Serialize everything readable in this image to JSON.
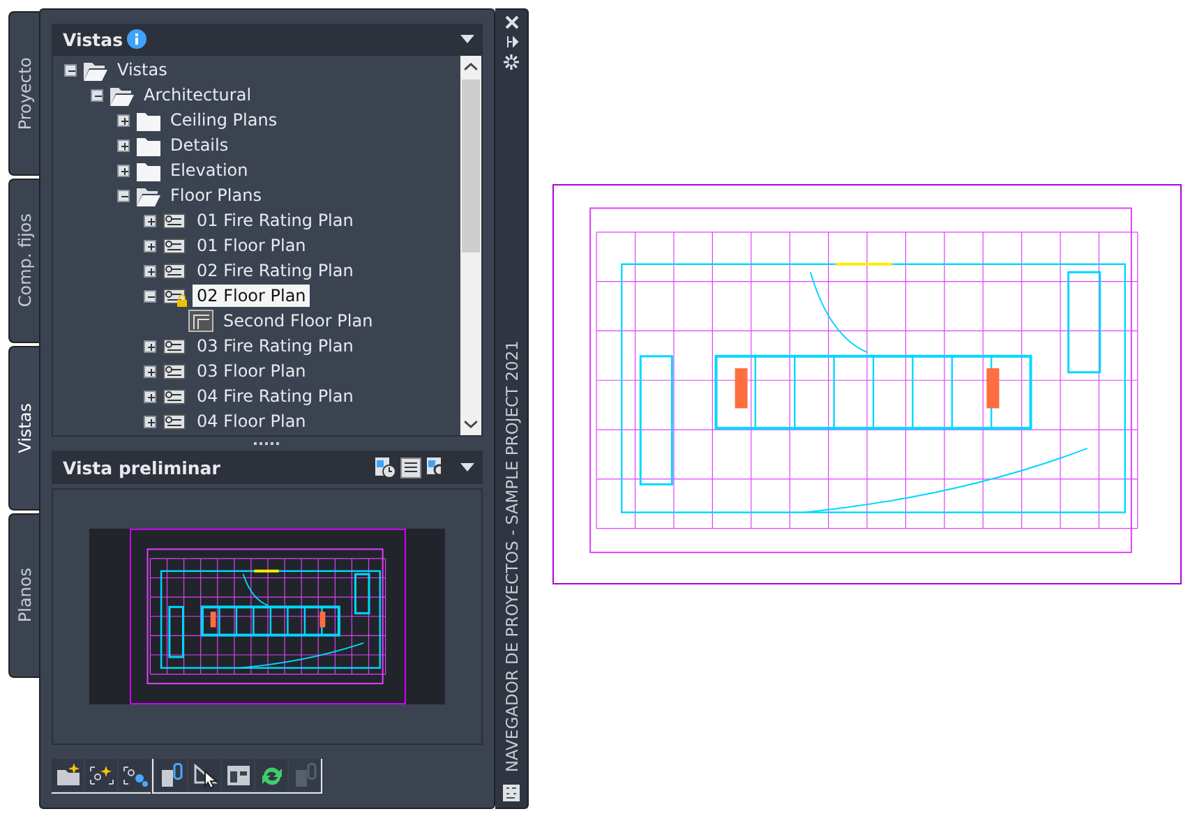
{
  "side_tabs": [
    {
      "label": "Proyecto",
      "selected": false
    },
    {
      "label": "Comp. fijos",
      "selected": false
    },
    {
      "label": "Vistas",
      "selected": true
    },
    {
      "label": "Planos",
      "selected": false
    }
  ],
  "views_panel": {
    "title": "Vistas",
    "tree": [
      {
        "label": "Vistas",
        "kind": "folder",
        "expanded": true,
        "selected": false,
        "children": [
          {
            "label": "Architectural",
            "kind": "folder",
            "expanded": true,
            "selected": false,
            "children": [
              {
                "label": "Ceiling Plans",
                "kind": "folder",
                "expanded": false,
                "selected": false
              },
              {
                "label": "Details",
                "kind": "folder",
                "expanded": false,
                "selected": false
              },
              {
                "label": "Elevation",
                "kind": "folder",
                "expanded": false,
                "selected": false
              },
              {
                "label": "Floor Plans",
                "kind": "folder",
                "expanded": true,
                "selected": false,
                "children": [
                  {
                    "label": "01 Fire Rating Plan",
                    "kind": "view",
                    "expanded": false,
                    "selected": false,
                    "locked": false
                  },
                  {
                    "label": "01 Floor Plan",
                    "kind": "view",
                    "expanded": false,
                    "selected": false,
                    "locked": false
                  },
                  {
                    "label": "02 Fire Rating Plan",
                    "kind": "view",
                    "expanded": false,
                    "selected": false,
                    "locked": false
                  },
                  {
                    "label": "02 Floor Plan",
                    "kind": "view",
                    "expanded": true,
                    "selected": true,
                    "locked": true,
                    "children": [
                      {
                        "label": "Second Floor Plan",
                        "kind": "subview",
                        "selected": false
                      }
                    ]
                  },
                  {
                    "label": "03 Fire Rating Plan",
                    "kind": "view",
                    "expanded": false,
                    "selected": false,
                    "locked": false
                  },
                  {
                    "label": "03 Floor Plan",
                    "kind": "view",
                    "expanded": false,
                    "selected": false,
                    "locked": false
                  },
                  {
                    "label": "04 Fire Rating Plan",
                    "kind": "view",
                    "expanded": false,
                    "selected": false,
                    "locked": false
                  },
                  {
                    "label": "04 Floor Plan",
                    "kind": "view",
                    "expanded": false,
                    "selected": false,
                    "locked": false
                  }
                ]
              }
            ]
          }
        ]
      }
    ]
  },
  "preview_panel": {
    "title": "Vista preliminar"
  },
  "bottom_toolbar": [
    {
      "kind": "new-folder",
      "disabled": false
    },
    {
      "kind": "new-view",
      "disabled": false
    },
    {
      "kind": "view-settings",
      "disabled": false
    },
    {
      "kind": "attach",
      "disabled": false
    },
    {
      "kind": "select",
      "disabled": false
    },
    {
      "kind": "layout",
      "disabled": false
    },
    {
      "kind": "refresh",
      "disabled": false
    },
    {
      "kind": "detach",
      "disabled": true
    }
  ],
  "palette_title": "NAVEGADOR DE PROYECTOS - SAMPLE PROJECT 2021"
}
